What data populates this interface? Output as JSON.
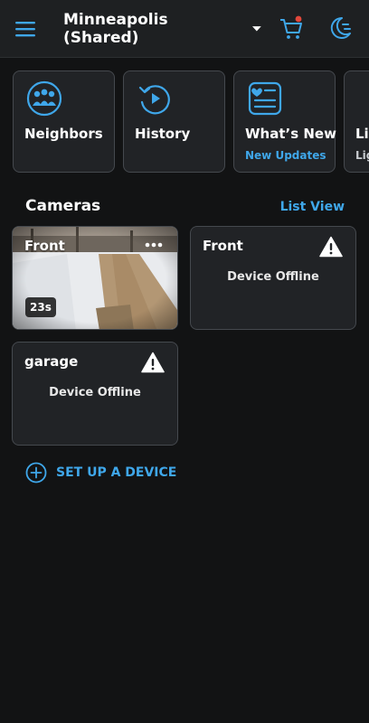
{
  "header": {
    "location": "Minneapolis (Shared)",
    "cart_has_notification": true,
    "icons": [
      "menu-icon",
      "chevron-down-icon",
      "cart-icon",
      "dark-mode-icon"
    ]
  },
  "tiles": [
    {
      "label": "Neighbors",
      "sub": "",
      "icon": "neighbors-icon"
    },
    {
      "label": "History",
      "sub": "",
      "icon": "history-icon"
    },
    {
      "label": "What’s New",
      "sub": "New Updates",
      "icon": "whats-new-icon"
    },
    {
      "label": "Li",
      "sub": "Lig",
      "icon": "unknown"
    }
  ],
  "cameras": {
    "title": "Cameras",
    "list_view_label": "List View",
    "items": [
      {
        "name": "Front",
        "status": "live",
        "snapshot_age": "23s"
      },
      {
        "name": "Front",
        "status": "Device Offline"
      },
      {
        "name": "garage",
        "status": "Device Offline"
      }
    ]
  },
  "setup_label": "SET UP A DEVICE",
  "colors": {
    "background": "#121314",
    "header": "#1e2022",
    "card": "#212326",
    "border": "#45494e",
    "accent": "#3fa7ea",
    "notification": "#e2473b"
  }
}
